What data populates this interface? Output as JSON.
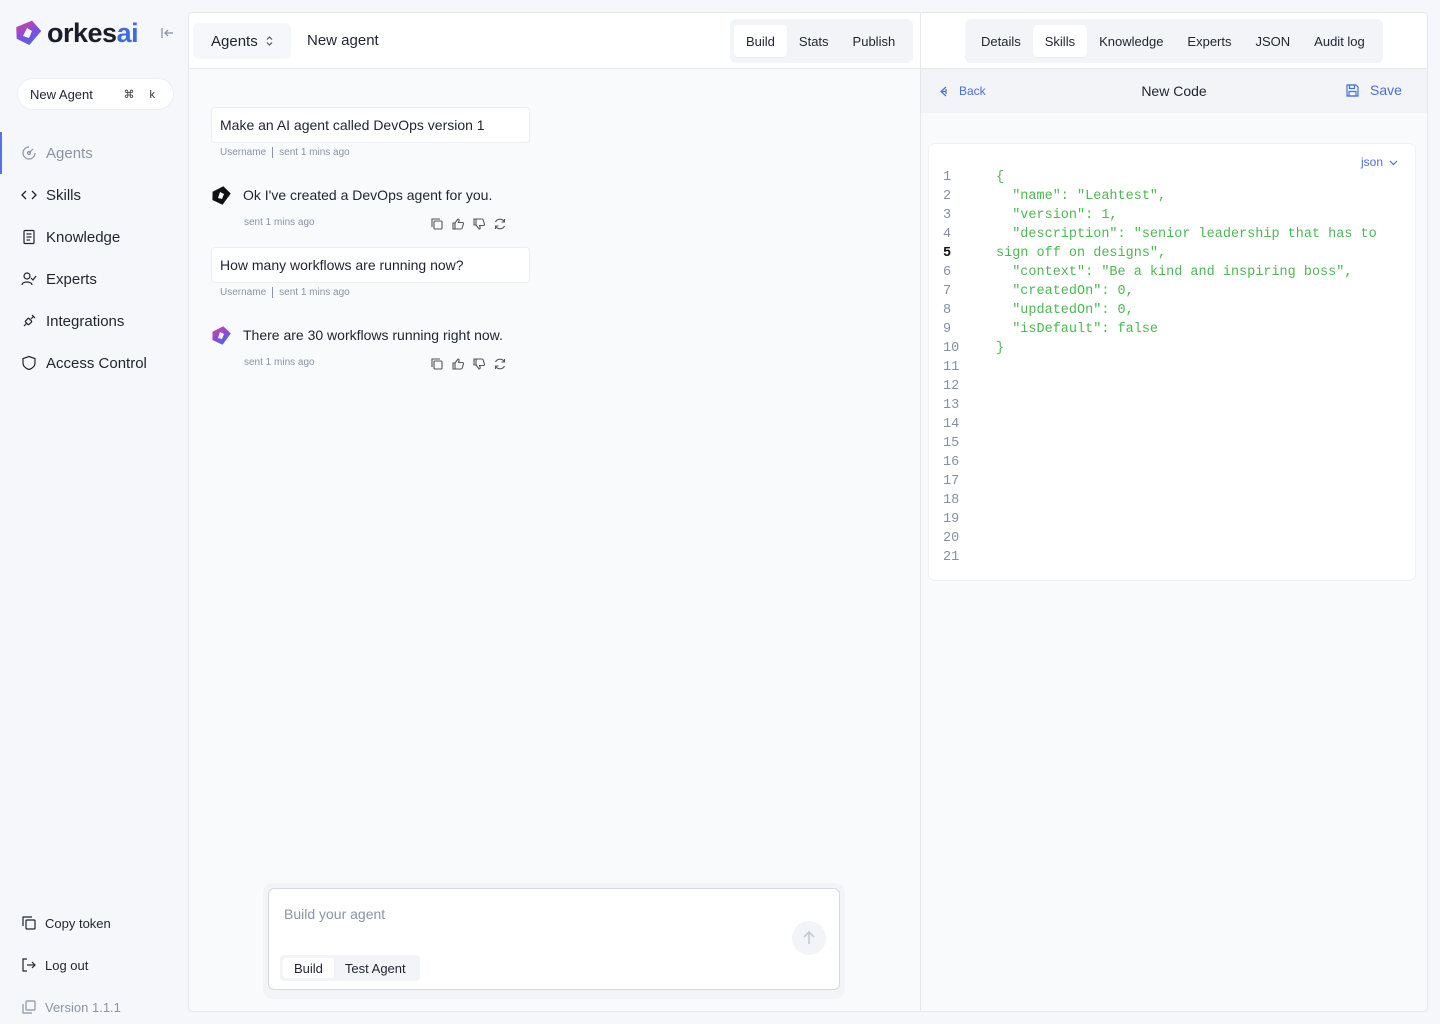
{
  "brand": {
    "name": "orkes",
    "suffix": "ai"
  },
  "sidebar": {
    "new_agent": {
      "label": "New Agent",
      "shortcut": "⌘ k"
    },
    "items": [
      {
        "label": "Agents",
        "icon": "agents-icon",
        "active": true
      },
      {
        "label": "Skills",
        "icon": "code-brackets-icon"
      },
      {
        "label": "Knowledge",
        "icon": "book-icon"
      },
      {
        "label": "Experts",
        "icon": "user-check-icon"
      },
      {
        "label": "Integrations",
        "icon": "plug-icon"
      },
      {
        "label": "Access Control",
        "icon": "shield-icon"
      }
    ],
    "bottom": {
      "copy_token": "Copy token",
      "log_out": "Log out",
      "version": "Version 1.1.1"
    }
  },
  "topbar": {
    "selector": "Agents",
    "agent_name": "New agent",
    "tabs": [
      "Build",
      "Stats",
      "Publish"
    ],
    "active_tab": "Build"
  },
  "right_tabs": {
    "tabs": [
      "Details",
      "Skills",
      "Knowledge",
      "Experts",
      "JSON",
      "Audit log"
    ],
    "active_tab": "Skills"
  },
  "chat": {
    "messages": [
      {
        "role": "user",
        "text": "Make an AI agent called DevOps version 1",
        "author": "Username",
        "time": "sent 1 mins ago"
      },
      {
        "role": "bot",
        "text": "Ok I've created a DevOps agent for you.",
        "time": "sent 1 mins ago"
      },
      {
        "role": "user",
        "text": "How many workflows are running now?",
        "author": "Username",
        "time": "sent 1 mins ago"
      },
      {
        "role": "bot",
        "text": "There are 30 workflows running right now.",
        "time": "sent 1 mins ago"
      }
    ]
  },
  "composer": {
    "placeholder": "Build your agent",
    "modes": [
      "Build",
      "Test Agent"
    ],
    "active_mode": "Build"
  },
  "editor": {
    "back": "Back",
    "title": "New Code",
    "save": "Save",
    "language": "json",
    "current_line": 5,
    "lines": [
      "{",
      "  \"name\": \"Leahtest\",",
      "  \"version\": 1,",
      "  \"description\": \"senior leadership that has to",
      "sign off on designs\",",
      "  \"context\": \"Be a kind and inspiring boss\",",
      "  \"createdOn\": 0,",
      "  \"updatedOn\": 0,",
      "  \"isDefault\": false",
      "}"
    ],
    "gutter": [
      "1",
      "2",
      "3",
      "4",
      "5",
      "6",
      "7",
      "8",
      "9",
      "10",
      "11",
      "12",
      "13",
      "14",
      "15",
      "16",
      "17",
      "18",
      "19",
      "20",
      "21"
    ]
  },
  "colors": {
    "accent": "#4a6fdc",
    "code": "#4db853",
    "active_bar": "#5b6ee6"
  }
}
